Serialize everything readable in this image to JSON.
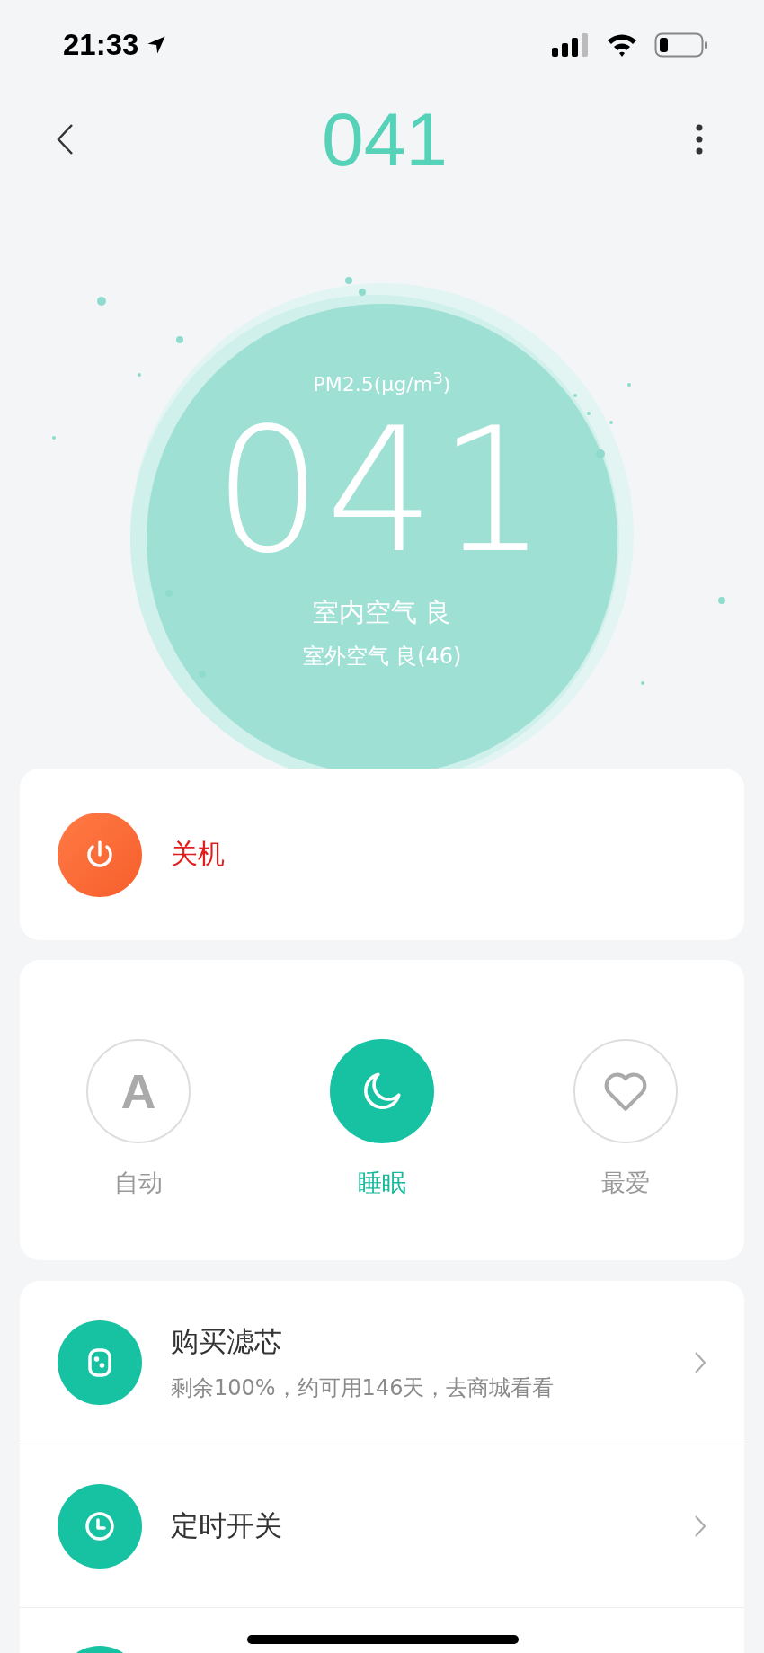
{
  "status_bar": {
    "time": "21:33"
  },
  "nav": {
    "title": "041"
  },
  "gauge": {
    "label": "PM2.5(µg/m$^{3}$)",
    "value": "041",
    "indoor": "室内空气 良",
    "outdoor": "室外空气 良(46)"
  },
  "power": {
    "label": "关机",
    "on": true
  },
  "modes": [
    {
      "kind": "auto",
      "glyph": "A",
      "label": "自动",
      "selected": false
    },
    {
      "kind": "sleep",
      "label": "睡眠",
      "selected": true
    },
    {
      "kind": "favorite",
      "label": "最爱",
      "selected": false
    }
  ],
  "menu": [
    {
      "kind": "filter",
      "title": "购买滤芯",
      "subtitle": "剩余100%，约可用146天，去商城看看"
    },
    {
      "kind": "timer",
      "title": "定时开关"
    }
  ]
}
